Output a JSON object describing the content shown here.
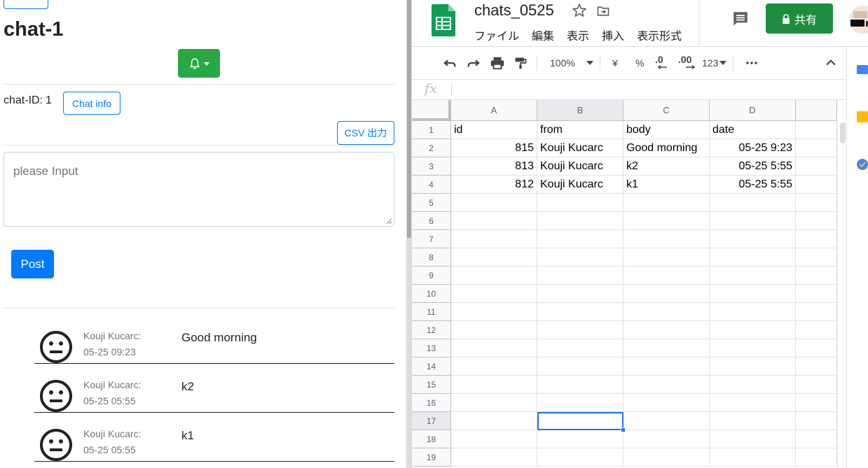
{
  "chat": {
    "title": "chat-1",
    "chat_id_label": "chat-ID:",
    "chat_id_value": "1",
    "chat_info_label": "Chat info",
    "csv_label": "CSV 出力",
    "input_placeholder": "please Input",
    "post_label": "Post",
    "messages": [
      {
        "sender": "Kouji Kucarc:",
        "time": "05-25 09:23",
        "body": "Good morning"
      },
      {
        "sender": "Kouji Kucarc:",
        "time": "05-25 05:55",
        "body": "k2"
      },
      {
        "sender": "Kouji Kucarc:",
        "time": "05-25 05:55",
        "body": "k1"
      }
    ]
  },
  "sheets": {
    "doc_title": "chats_0525",
    "menu": [
      "ファイル",
      "編集",
      "表示",
      "挿入",
      "表示形式"
    ],
    "share_label": "共有",
    "toolbar": {
      "zoom": "100%",
      "currency": "¥",
      "percent": "%",
      "dec_decrease": ".0",
      "dec_increase": ".00",
      "format": "123"
    },
    "fx_label": "fx",
    "columns": [
      "A",
      "B",
      "C",
      "D"
    ],
    "rows": [
      "1",
      "2",
      "3",
      "4",
      "5",
      "6",
      "7",
      "8",
      "9",
      "10",
      "11",
      "12",
      "13",
      "14",
      "15",
      "16",
      "17",
      "18",
      "19"
    ],
    "cells": [
      [
        "id",
        "from",
        "body",
        "date"
      ],
      [
        "815",
        "Kouji Kucarc",
        "Good morning",
        "05-25 9:23"
      ],
      [
        "813",
        "Kouji Kucarc",
        "k2",
        "05-25 5:55"
      ],
      [
        "812",
        "Kouji Kucarc",
        "k1",
        "05-25 5:55"
      ]
    ],
    "selected_cell": "B17"
  },
  "colors": {
    "bootstrap_primary": "#007bff",
    "bootstrap_success": "#28a745",
    "sheets_green": "#1e8e3e",
    "selection_blue": "#1a73e8"
  }
}
